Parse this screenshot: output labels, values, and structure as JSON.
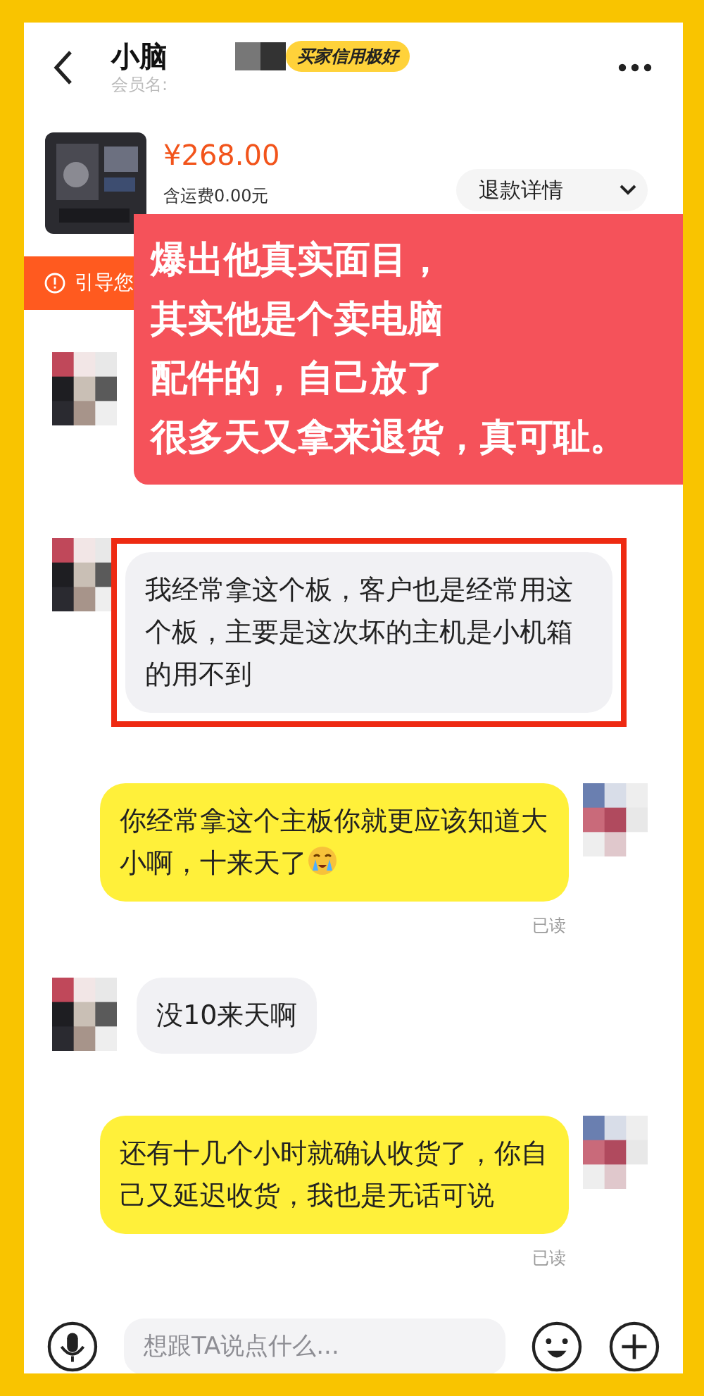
{
  "header": {
    "title": "小脑",
    "badge": "买家信用极好",
    "member_label": "会员名:"
  },
  "order": {
    "price": "¥268.00",
    "shipping": "含运费0.00元",
    "refund_button": "退款详情"
  },
  "notice": {
    "text": "引导您"
  },
  "caption": {
    "lines": [
      "爆出他真实面目，",
      "其实他是个卖电脑",
      "配件的，自己放了",
      "很多天又拿来退货，真可耻。"
    ]
  },
  "messages": [
    {
      "kind": "incoming"
    },
    {
      "kind": "incoming",
      "text": "我经常拿这个板，客户也是经常用这个板，主要是这次坏的主机是小机箱的用不到",
      "highlighted": true
    },
    {
      "kind": "outgoing",
      "text": "你经常拿这个主板你就更应该知道大小啊，十来天了",
      "sticker": true,
      "status": "已读"
    },
    {
      "kind": "incoming",
      "text": "没10来天啊"
    },
    {
      "kind": "outgoing",
      "text": "还有十几个小时就确认收货了，你自己又延迟收货，我也是无话可说",
      "status": "已读"
    }
  ],
  "input": {
    "placeholder": "想跟TA说点什么..."
  }
}
